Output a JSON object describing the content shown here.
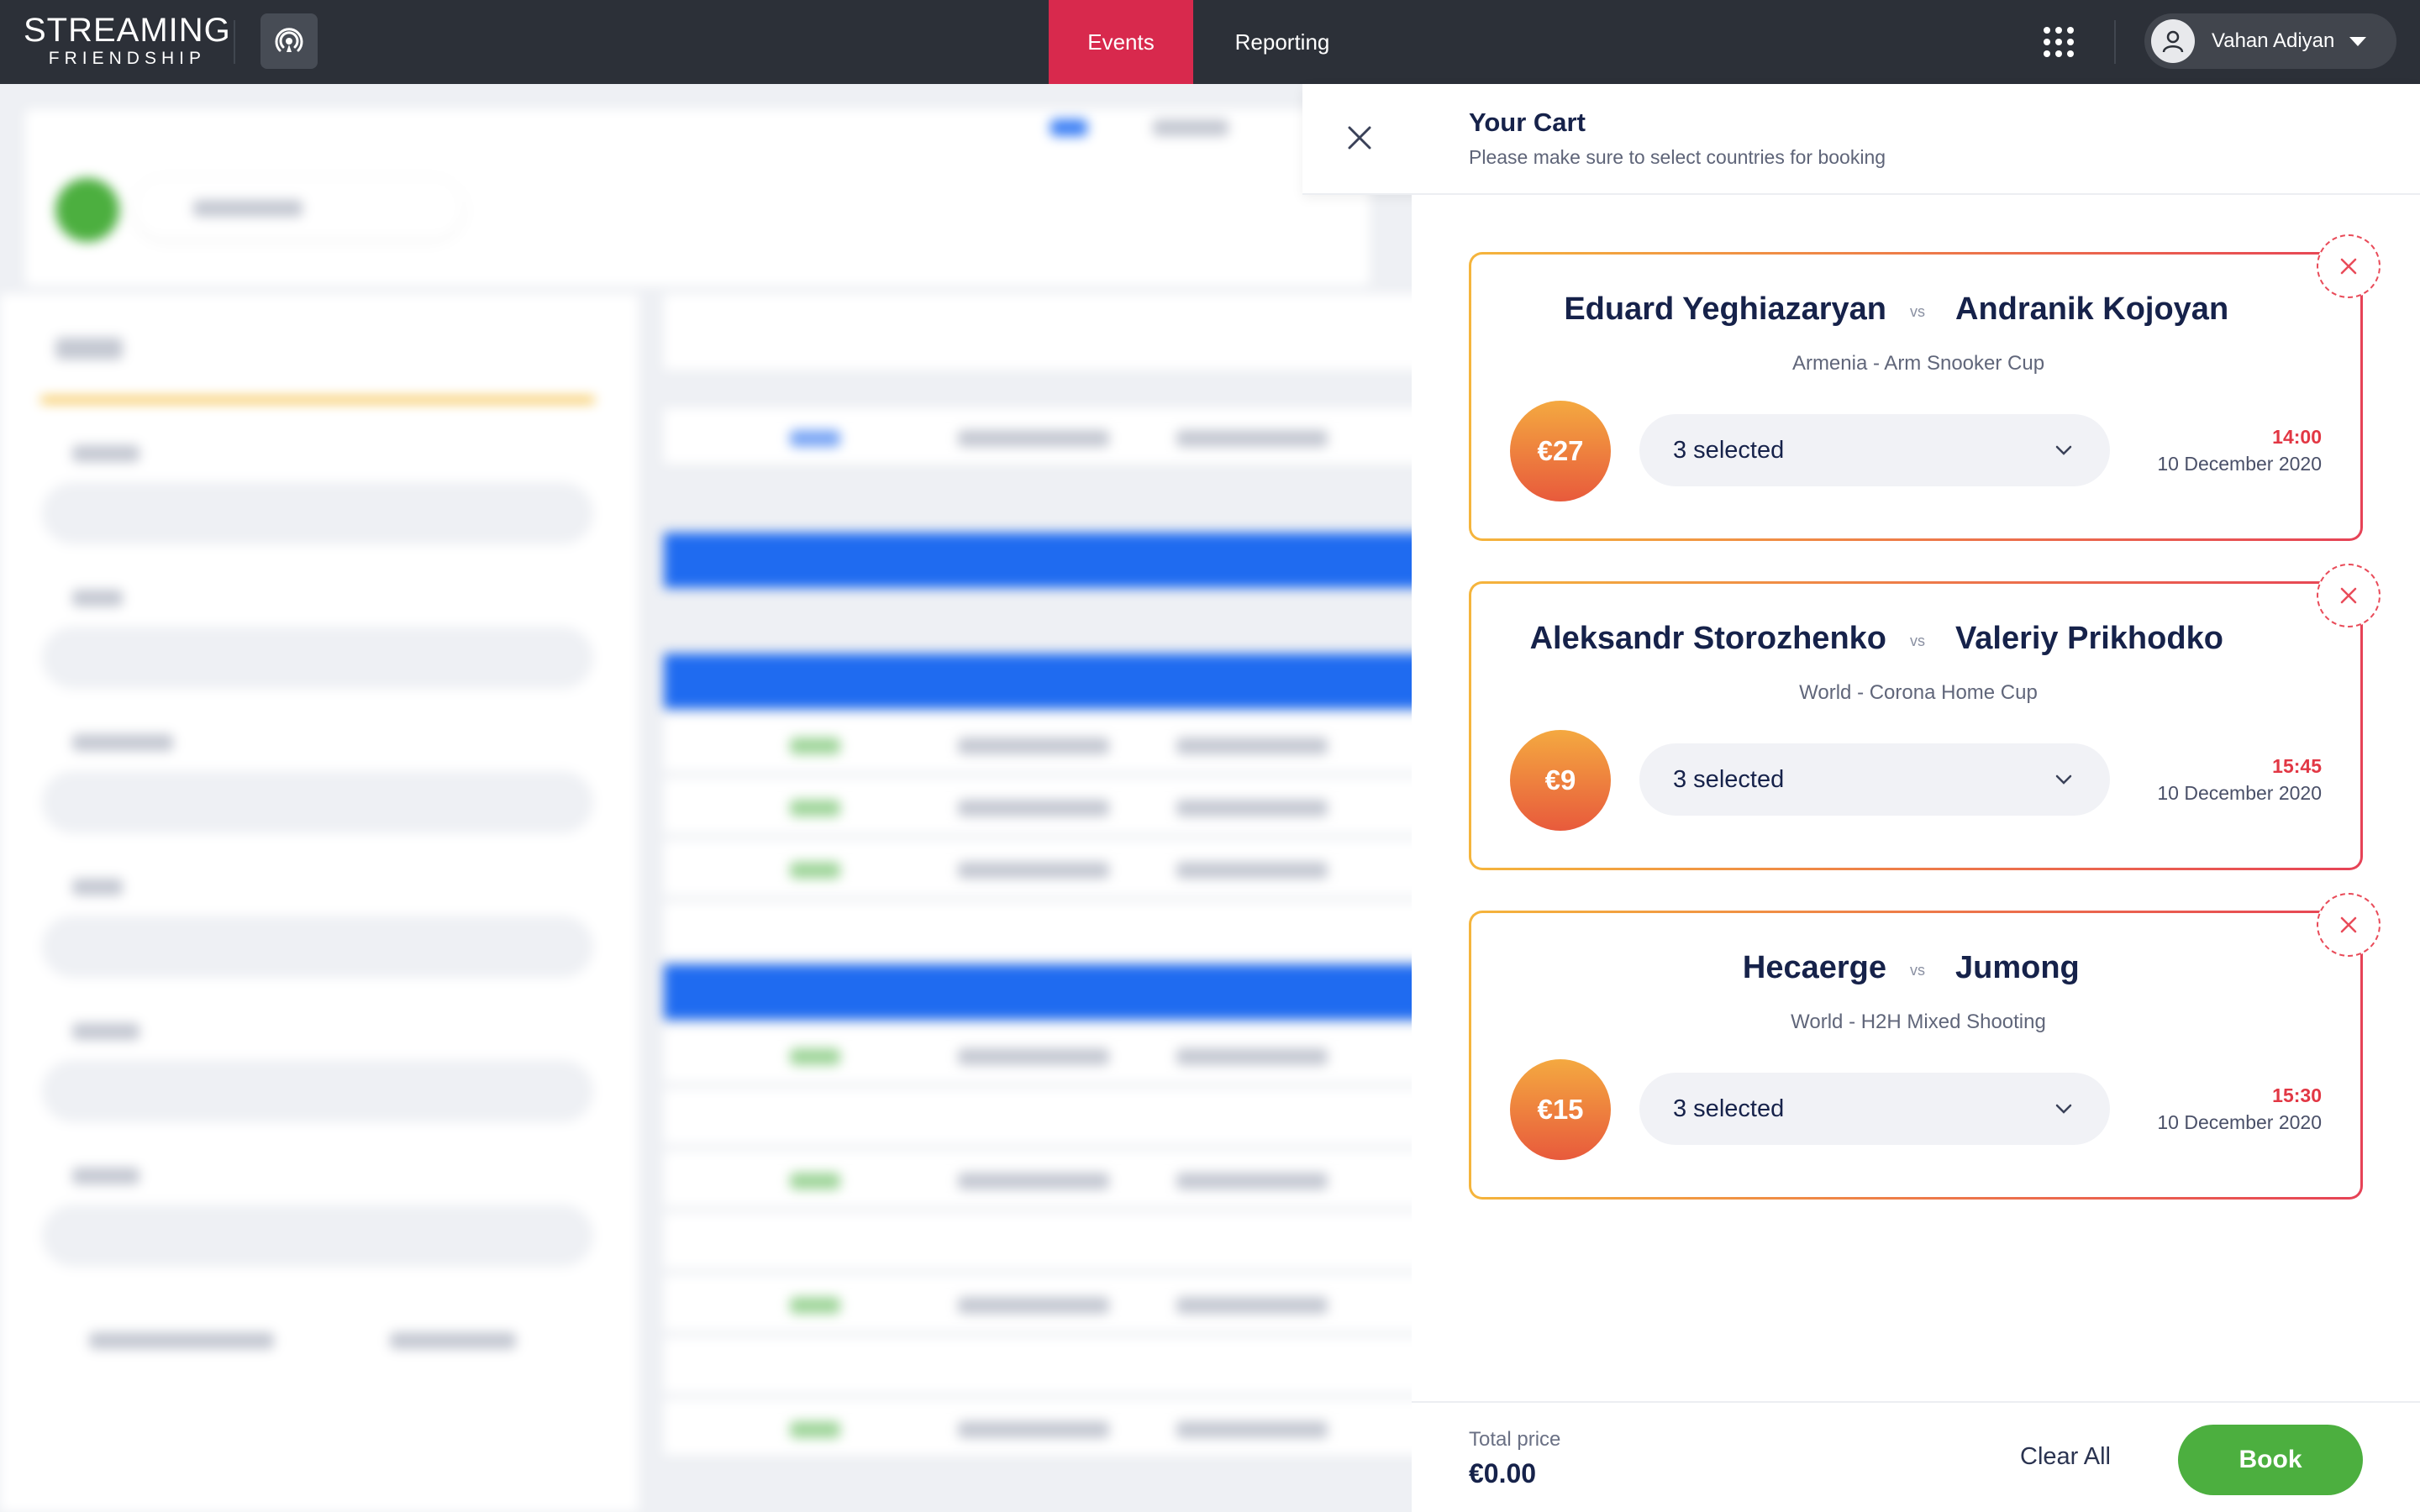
{
  "app": {
    "logo_line1": "STREAMING",
    "logo_line2": "FRIENDSHIP"
  },
  "nav": {
    "tabs": [
      {
        "label": "Events",
        "active": true
      },
      {
        "label": "Reporting",
        "active": false
      }
    ]
  },
  "user": {
    "name": "Vahan Adiyan"
  },
  "cart": {
    "title": "Your Cart",
    "subtitle": "Please make sure to select countries for booking",
    "items": [
      {
        "home": "Eduard Yeghiazaryan",
        "vs": "vs",
        "away": "Andranik Kojoyan",
        "league": "Armenia - Arm Snooker Cup",
        "price": "€27",
        "countries": "3 selected",
        "time": "14:00",
        "date": "10 December 2020"
      },
      {
        "home": "Aleksandr Storozhenko",
        "vs": "vs",
        "away": "Valeriy Prikhodko",
        "league": "World - Corona Home Cup",
        "price": "€9",
        "countries": "3 selected",
        "time": "15:45",
        "date": "10 December 2020"
      },
      {
        "home": "Hecaerge",
        "vs": "vs",
        "away": "Jumong",
        "league": "World - H2H Mixed Shooting",
        "price": "€15",
        "countries": "3 selected",
        "time": "15:30",
        "date": "10 December 2020"
      }
    ],
    "total_label": "Total price",
    "total_value": "€0.00",
    "clear_all": "Clear All",
    "book": "Book"
  },
  "colors": {
    "topbar": "#2c3038",
    "active_tab": "#d8294d",
    "book_button": "#4caf3f",
    "time_red": "#e23744"
  },
  "icons": [
    "cast-icon",
    "apps-grid-icon",
    "user-icon",
    "close-icon",
    "remove-icon",
    "chevron-down-icon"
  ]
}
